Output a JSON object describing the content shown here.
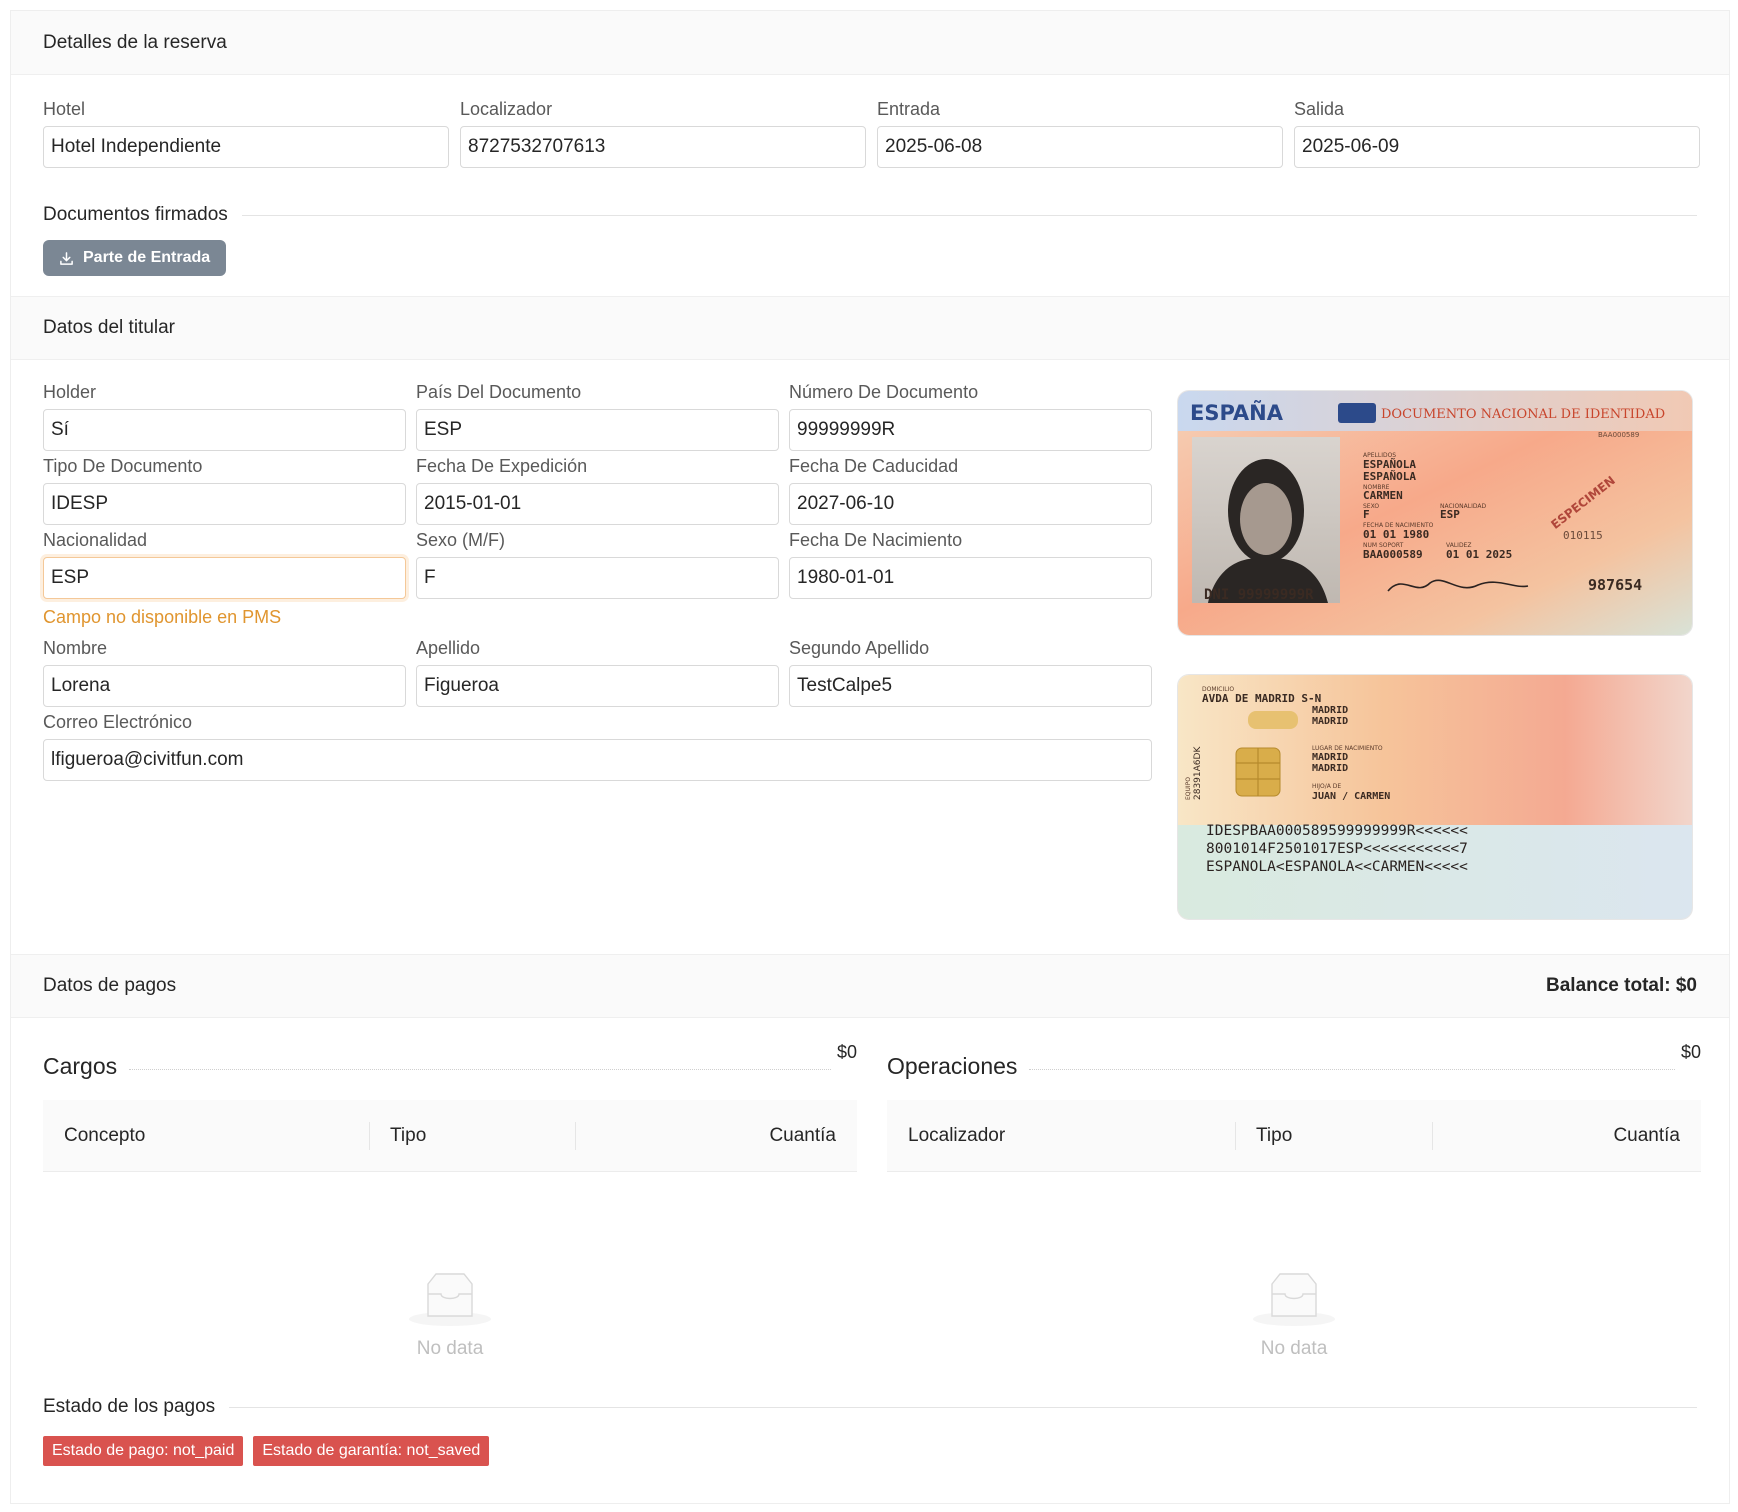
{
  "reservation": {
    "title": "Detalles de la reserva",
    "fields": [
      {
        "label": "Hotel",
        "value": "Hotel Independiente"
      },
      {
        "label": "Localizador",
        "value": "8727532707613"
      },
      {
        "label": "Entrada",
        "value": "2025-06-08"
      },
      {
        "label": "Salida",
        "value": "2025-06-09"
      }
    ],
    "signed_docs_title": "Documentos firmados",
    "download_button": "Parte de Entrada"
  },
  "holder": {
    "title": "Datos del titular",
    "fields": {
      "holder": {
        "label": "Holder",
        "value": "Sí"
      },
      "document_country": {
        "label": "País Del Documento",
        "value": "ESP"
      },
      "document_number": {
        "label": "Número De Documento",
        "value": "99999999R"
      },
      "document_type": {
        "label": "Tipo De Documento",
        "value": "IDESP"
      },
      "issue_date": {
        "label": "Fecha De Expedición",
        "value": "2015-01-01"
      },
      "expiry_date": {
        "label": "Fecha De Caducidad",
        "value": "2027-06-10"
      },
      "nationality": {
        "label": "Nacionalidad",
        "value": "ESP",
        "help": "Campo no disponible en PMS"
      },
      "sex": {
        "label": "Sexo (M/F)",
        "value": "F"
      },
      "birth_date": {
        "label": "Fecha De Nacimiento",
        "value": "1980-01-01"
      },
      "name": {
        "label": "Nombre",
        "value": "Lorena"
      },
      "surname": {
        "label": "Apellido",
        "value": "Figueroa"
      },
      "second_surname": {
        "label": "Segundo Apellido",
        "value": "TestCalpe5"
      },
      "email": {
        "label": "Correo Electrónico",
        "value": "lfigueroa@civitfun.com"
      }
    },
    "id_front": {
      "country": "ESPAÑA",
      "doc_title": "DOCUMENTO NACIONAL DE IDENTIDAD",
      "surname_label": "APELLIDOS",
      "surname1": "ESPAÑOLA",
      "surname2": "ESPAÑOLA",
      "name_label": "NOMBRE",
      "name": "CARMEN",
      "sex_label": "SEXO",
      "sex": "F",
      "nationality_label": "NACIONALIDAD",
      "nationality": "ESP",
      "birth_label": "FECHA DE NACIMIENTO",
      "birth": "01 01 1980",
      "support_label": "NUM SOPORT",
      "support": "BAA000589",
      "valid_label": "VALIDEZ",
      "valid": "01 01 2025",
      "can": "010115",
      "dni": "DNI 99999999R",
      "number": "987654",
      "specimen": "ESPECIMEN",
      "code": "BAA000589"
    },
    "id_back": {
      "address_label": "DOMICILIO",
      "address": "AVDA DE MADRID S-N",
      "city1": "MADRID",
      "city2": "MADRID",
      "birthplace_label": "LUGAR DE NACIMIENTO",
      "birthplace1": "MADRID",
      "birthplace2": "MADRID",
      "parents_label": "HIJO/A DE",
      "parents": "JUAN / CARMEN",
      "side_code": "28391A6DK",
      "side_label": "EQUIPO",
      "mrz1": "IDESPBAA000589599999999R<<<<<<",
      "mrz2": "8001014F2501017ESP<<<<<<<<<<<7",
      "mrz3": "ESPANOLA<ESPANOLA<<CARMEN<<<<<"
    }
  },
  "payments": {
    "title": "Datos de pagos",
    "balance": "Balance total: $0",
    "charges": {
      "title": "Cargos",
      "amount": "$0",
      "columns": [
        "Concepto",
        "Tipo",
        "Cuantía"
      ],
      "empty": "No data"
    },
    "operations": {
      "title": "Operaciones",
      "amount": "$0",
      "columns": [
        "Localizador",
        "Tipo",
        "Cuantía"
      ],
      "empty": "No data"
    },
    "status_title": "Estado de los pagos",
    "tags": [
      "Estado de pago: not_paid",
      "Estado de garantía: not_saved"
    ],
    "tag_color": "#d9534f"
  },
  "colors": {
    "warning": "#e0952f",
    "button": "#7b8794"
  }
}
